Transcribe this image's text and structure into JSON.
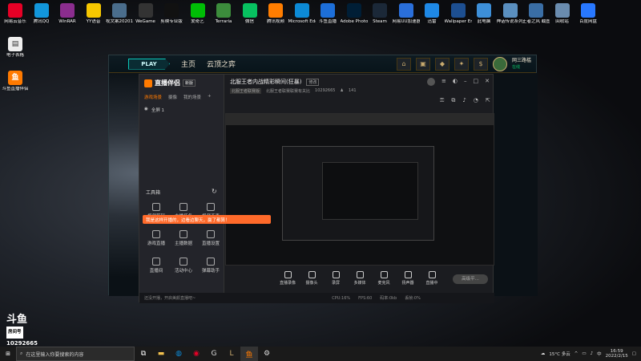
{
  "desktop_icons": [
    {
      "label": "网易云音乐",
      "icon": "netease-cloud-music-icon",
      "color": "#e60026"
    },
    {
      "label": "腾讯QQ",
      "icon": "qq-icon",
      "color": "#1296db"
    },
    {
      "label": "WinRAR",
      "icon": "winrar-icon",
      "color": "#8b2d8e"
    },
    {
      "label": "YY语音",
      "icon": "yy-icon",
      "color": "#f6c700"
    },
    {
      "label": "视文案20201301...",
      "icon": "document-icon",
      "color": "#4a6d8c"
    },
    {
      "label": "WeGame",
      "icon": "wegame-icon",
      "color": "#333"
    },
    {
      "label": "剪映专业版",
      "icon": "jianying-icon",
      "color": "#111"
    },
    {
      "label": "爱奇艺",
      "icon": "iqiyi-icon",
      "color": "#00be06"
    },
    {
      "label": "Terraria",
      "icon": "terraria-icon",
      "color": "#3c8c3c"
    },
    {
      "label": "微信",
      "icon": "wechat-icon",
      "color": "#07c160"
    },
    {
      "label": "腾讯视频",
      "icon": "tencent-video-icon",
      "color": "#ff7d00"
    },
    {
      "label": "Microsoft Edge",
      "icon": "edge-icon",
      "color": "#0c8ad6"
    },
    {
      "label": "斗鱼直播",
      "icon": "douyu-live-icon",
      "color": "#1d6fd9"
    },
    {
      "label": "Adobe Photosh...",
      "icon": "photoshop-icon",
      "color": "#001e36"
    },
    {
      "label": "Steam",
      "icon": "steam-icon",
      "color": "#1b2838"
    },
    {
      "label": "网易UU加速器",
      "icon": "uu-accelerator-icon",
      "color": "#2a6fdb"
    },
    {
      "label": "迅雷",
      "icon": "xunlei-icon",
      "color": "#1e88e5"
    },
    {
      "label": "Wallpaper Engine: ...",
      "icon": "wallpaper-engine-icon",
      "color": "#1d4f91"
    },
    {
      "label": "此电脑",
      "icon": "computer-icon",
      "color": "#3d8fd8"
    },
    {
      "label": "神话传说系列游戏",
      "icon": "game-icon",
      "color": "#5a8fbf"
    },
    {
      "label": "王者之风 截图工具",
      "icon": "screenshot-icon",
      "color": "#3a6ea5"
    },
    {
      "label": "回收站",
      "icon": "recycle-bin-icon",
      "color": "#6a8caf"
    },
    {
      "label": "百度网盘",
      "icon": "baidu-netdisk-icon",
      "color": "#2878ff"
    }
  ],
  "left_icons": [
    {
      "label": "电子表格",
      "icon": "spreadsheet-doc-icon",
      "color": "#ddd"
    },
    {
      "label": "斗鱼直播伴侣",
      "icon": "douyu-companion-icon",
      "color": "#ff7a00"
    }
  ],
  "lol": {
    "play": "PLAY",
    "nav": [
      "主页",
      "云顶之弈"
    ],
    "right_icons": [
      "主页",
      "商城",
      "战利品",
      "藏品",
      "商城"
    ],
    "username": "网三路槛",
    "status": "在线"
  },
  "douyu": {
    "logo": "直播伴侣",
    "badge": "新版",
    "left_tabs": [
      "游戏场景",
      "摄像",
      "我的场景"
    ],
    "scene_item": "全屏 1",
    "tools_title": "工具箱",
    "tools": [
      "视频剪辑",
      "主播任务",
      "视频连麦",
      "游戏直播",
      "主播数据",
      "直播设置",
      "直播间",
      "活动中心",
      "弹幕助手"
    ],
    "room_title": "北服王者内战精彩瞬间(狂暴)",
    "room_tag": "修改",
    "category": "北服王者联赛版",
    "room_info": "北服王者联赛联赛有关比",
    "room_id": "10292665",
    "viewer_count": "141",
    "toast": "我是这样开播的，边看边聊天，赢了都算！",
    "bottom_tools": [
      "直播录像",
      "摄像头",
      "录屏",
      "多媒体",
      "麦克风",
      "扬声器",
      "直播中"
    ],
    "start_button": "高级平...",
    "status_bar": [
      "CPU:16%",
      "FPS:60",
      "码率:0kb",
      "丢帧:0%"
    ],
    "status_msg": "还没开播，开启美颜直播吧~"
  },
  "taskbar": {
    "search_placeholder": "在这里输入你要搜索的内容",
    "weather": "15°C 多云",
    "time": "16:59",
    "date": "2022/2/15",
    "ime": "中"
  },
  "watermark": {
    "brand": "斗鱼",
    "room_label": "房间号",
    "room_id": "10292665"
  }
}
